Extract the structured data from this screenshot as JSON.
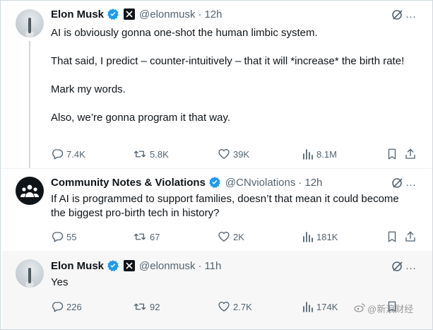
{
  "tweets": [
    {
      "name": "Elon Musk",
      "handle": "@elonmusk",
      "time": "12h",
      "text": "AI is obviously gonna one-shot the human limbic system.\n\nThat said, I predict – counter-intuitively – that it will *increase* the birth rate!\n\nMark my words.\n\nAlso, we’re gonna program it that way.",
      "stats": {
        "replies": "7.4K",
        "retweets": "5.8K",
        "likes": "39K",
        "views": "8.1M"
      }
    },
    {
      "name": "Community Notes & Violations",
      "handle": "@CNviolations",
      "time": "12h",
      "text": "If AI is programmed to support families, doesn’t that mean it could become the biggest pro-birth tech in history?",
      "stats": {
        "replies": "55",
        "retweets": "67",
        "likes": "2K",
        "views": "181K"
      }
    },
    {
      "name": "Elon Musk",
      "handle": "@elonmusk",
      "time": "11h",
      "text": "Yes",
      "stats": {
        "replies": "226",
        "retweets": "92",
        "likes": "2.7K",
        "views": "174K"
      }
    }
  ],
  "ui": {
    "dot": "·",
    "more": "···"
  },
  "watermark": {
    "text": "@新浪财经"
  },
  "colors": {
    "verified": "#1d9bf0",
    "muted": "#536471",
    "text": "#0f1419"
  }
}
